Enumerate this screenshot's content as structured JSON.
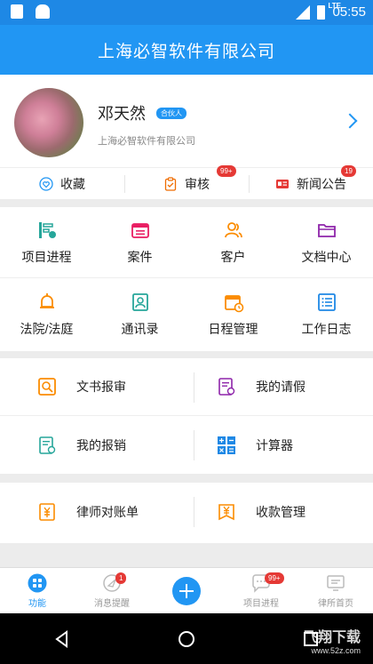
{
  "status_bar": {
    "time": "05:55",
    "network": "LTE"
  },
  "header": {
    "title": "上海必智软件有限公司"
  },
  "profile": {
    "name": "邓天然",
    "tag": "合伙人",
    "company": "上海必智软件有限公司"
  },
  "quick_actions": [
    {
      "label": "收藏",
      "icon": "heart-icon"
    },
    {
      "label": "审核",
      "icon": "clipboard-icon",
      "badge": "99+"
    },
    {
      "label": "新闻公告",
      "icon": "news-icon",
      "badge": "19"
    }
  ],
  "modules_row1": [
    {
      "label": "项目进程",
      "icon": "project-icon"
    },
    {
      "label": "案件",
      "icon": "case-icon"
    },
    {
      "label": "客户",
      "icon": "customer-icon"
    },
    {
      "label": "文档中心",
      "icon": "folder-icon"
    }
  ],
  "modules_row2": [
    {
      "label": "法院/法庭",
      "icon": "bell-icon"
    },
    {
      "label": "通讯录",
      "icon": "contacts-icon"
    },
    {
      "label": "日程管理",
      "icon": "calendar-icon"
    },
    {
      "label": "工作日志",
      "icon": "list-icon"
    }
  ],
  "list_section_a": [
    {
      "label": "文书报审",
      "icon": "document-review-icon"
    },
    {
      "label": "我的请假",
      "icon": "leave-icon"
    },
    {
      "label": "我的报销",
      "icon": "reimburse-icon"
    },
    {
      "label": "计算器",
      "icon": "calculator-icon"
    }
  ],
  "list_section_b": [
    {
      "label": "律师对账单",
      "icon": "statement-icon"
    },
    {
      "label": "收款管理",
      "icon": "payment-icon"
    }
  ],
  "tab_bar": [
    {
      "label": "功能",
      "icon": "grid-icon",
      "active": true
    },
    {
      "label": "消息提醒",
      "icon": "message-icon",
      "badge": "1"
    },
    {
      "label": "",
      "icon": "plus-icon"
    },
    {
      "label": "项目进程",
      "icon": "chat-icon",
      "badge": "99+"
    },
    {
      "label": "律所首页",
      "icon": "monitor-icon"
    }
  ],
  "watermark": {
    "line1": "飞翔下载",
    "line2": "www.52z.com"
  },
  "colors": {
    "primary": "#2196f3",
    "badge": "#e53935"
  }
}
